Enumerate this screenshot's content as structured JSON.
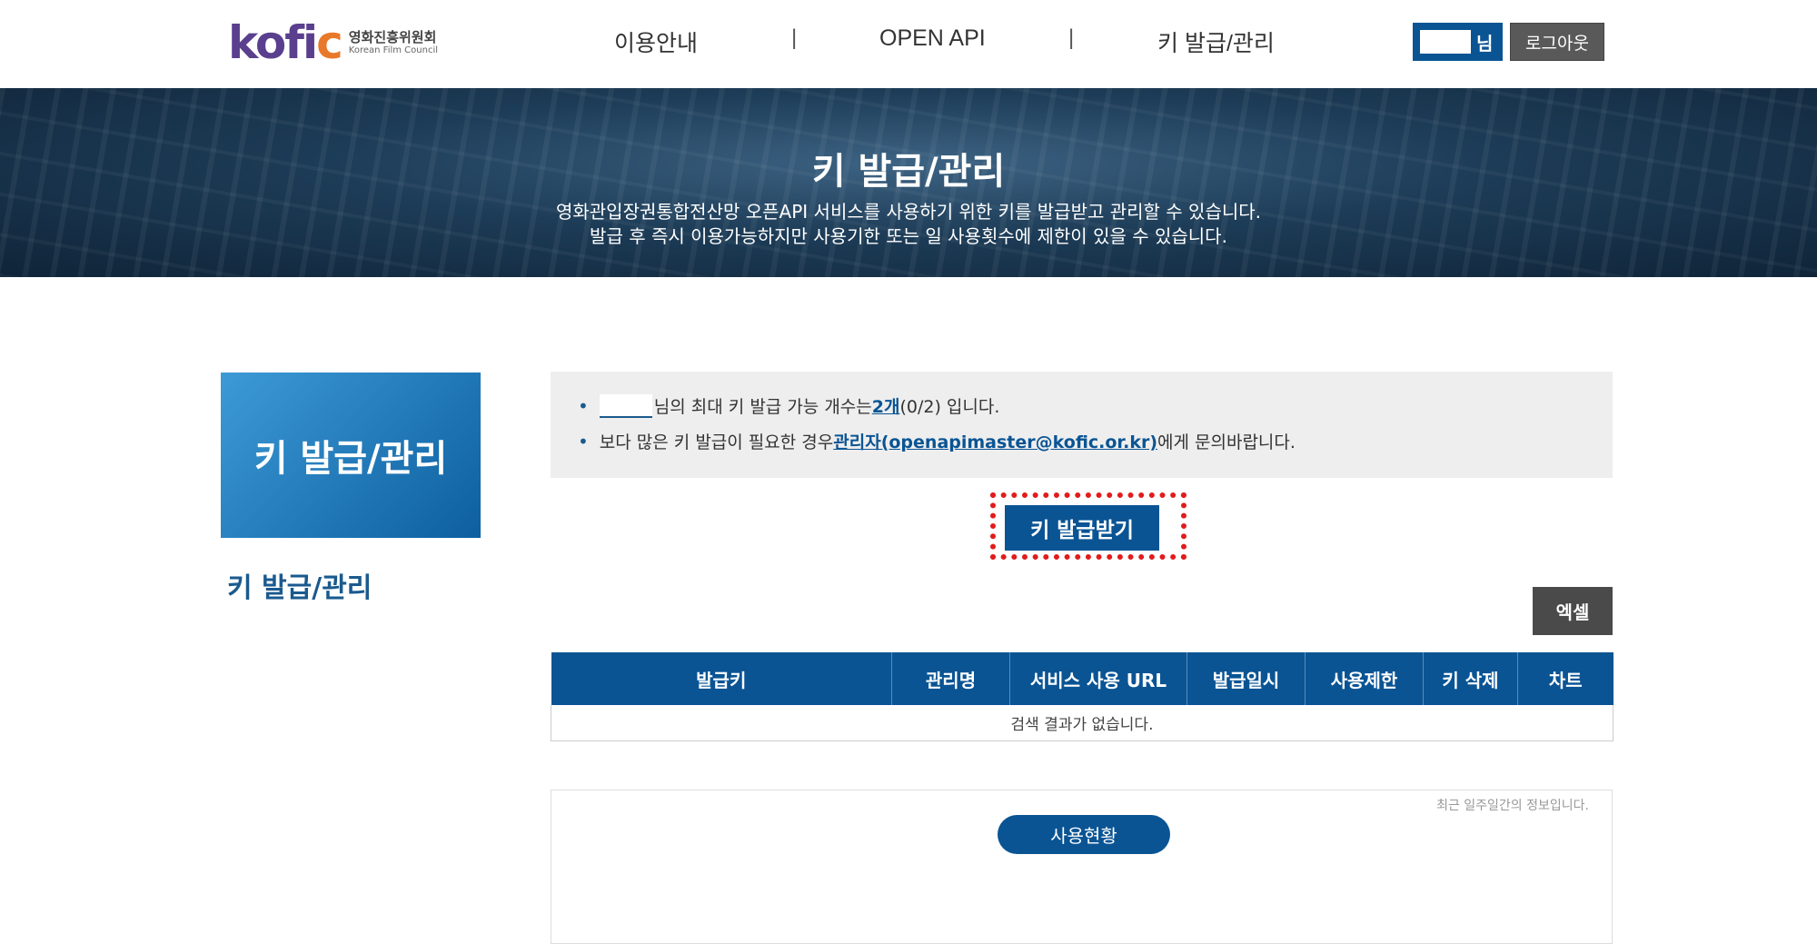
{
  "header": {
    "logo_text_main": "kofi",
    "logo_text_accent": "c",
    "logo_kr": "영화진흥위원회",
    "logo_en": "Korean Film Council",
    "nav": [
      "이용안내",
      "OPEN API",
      "키 발급/관리"
    ],
    "nav_separator": "|",
    "user_suffix": "님",
    "logout_label": "로그아웃"
  },
  "banner": {
    "title": "키 발급/관리",
    "line1": "영화관입장권통합전산망 오픈API 서비스를 사용하기 위한 키를 발급받고 관리할 수 있습니다.",
    "line2": "발급 후 즉시 이용가능하지만 사용기한 또는 일 사용횟수에 제한이 있을 수 있습니다."
  },
  "sidebar": {
    "box_title": "키 발급/관리",
    "link_label": "키 발급/관리"
  },
  "notice": {
    "bullet": "•",
    "row1_prefix": "님의 최대 키 발급 가능 개수는 ",
    "row1_count": "2개",
    "row1_suffix": "(0/2) 입니다.",
    "row2_prefix": "보다 많은 키 발급이 필요한 경우 ",
    "row2_link": "관리자(openapimaster@kofic.or.kr)",
    "row2_suffix": "에게 문의바랍니다."
  },
  "actions": {
    "issue_label": "키 발급받기",
    "excel_label": "엑셀"
  },
  "table": {
    "columns": [
      "발급키",
      "관리명",
      "서비스 사용 URL",
      "발급일시",
      "사용제한",
      "키 삭제",
      "차트"
    ],
    "empty_message": "검색 결과가 없습니다."
  },
  "usage": {
    "note": "최근 일주일간의 정보입니다.",
    "pill_label": "사용현황"
  },
  "colors": {
    "primary": "#0a5494",
    "highlight_frame": "#e21b1b",
    "logo_purple": "#5a3f8e",
    "logo_orange": "#e8792a"
  }
}
